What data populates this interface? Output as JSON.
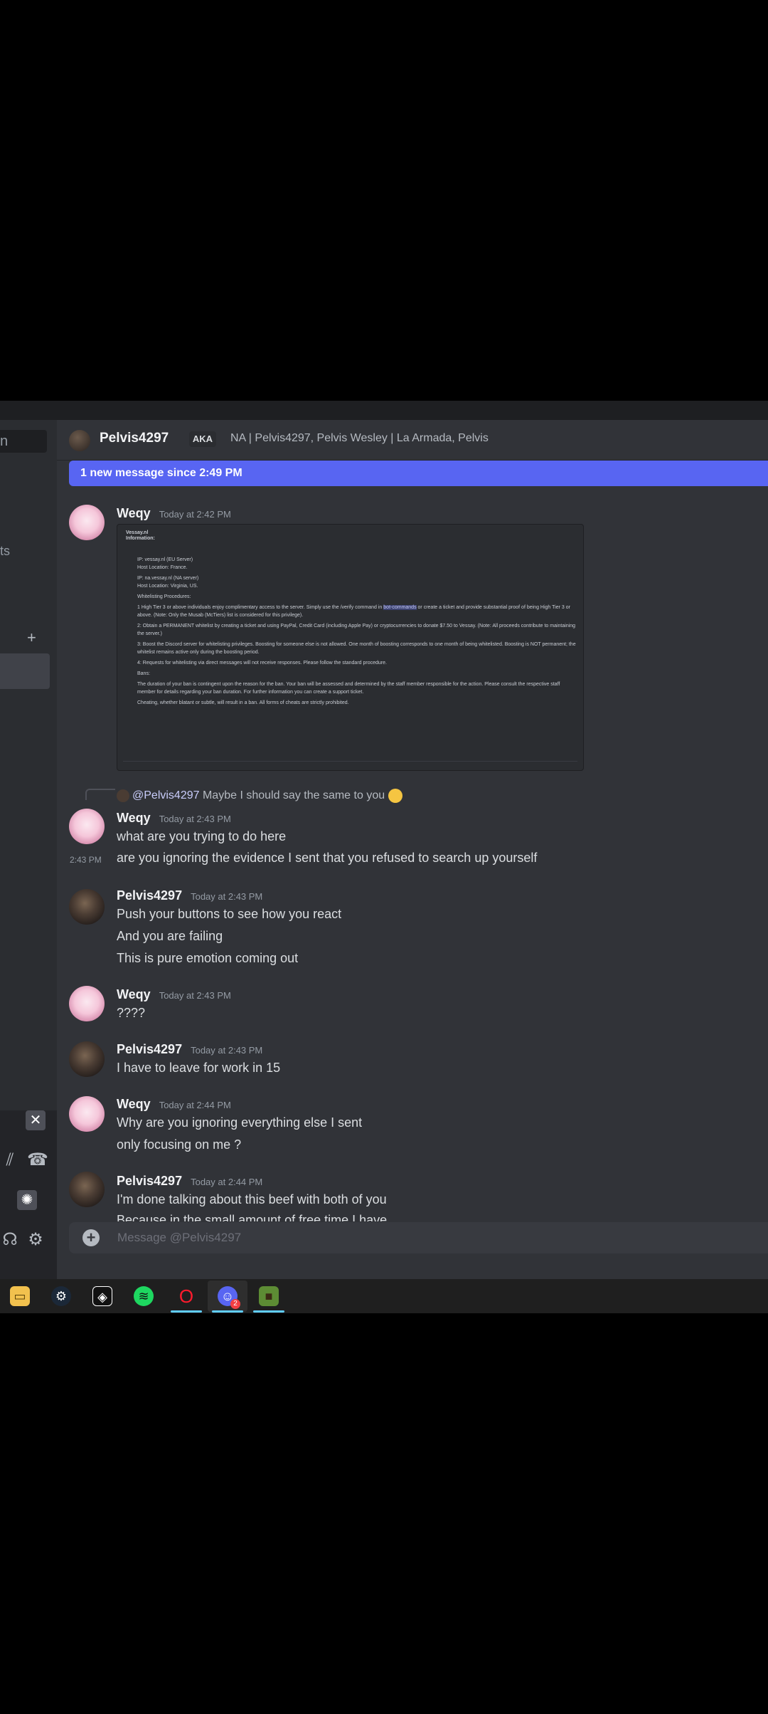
{
  "sidebar": {
    "search_text": "n",
    "fragment_text": "ts",
    "add_label": "+"
  },
  "header": {
    "channel_name": "Pelvis4297",
    "aka_label": "AKA",
    "aka_names": "NA | Pelvis4297, Pelvis Wesley | La Armada, Pelvis"
  },
  "new_messages_bar": "1 new message since 2:49 PM",
  "attachment": {
    "title": "Vessay.nl",
    "subtitle": "Information:",
    "lines": [
      "IP: vessay.nl (EU Server)",
      "Host Location: France.",
      "IP: na.vessay.nl (NA server)",
      "Host Location: Virginia, US.",
      "Whitelisting Procedures:",
      "1 High Tier 3 or above individuals enjoy complimentary access to the server. Simply use the /verify command in",
      "bot-commands",
      "or create a ticket and provide substantial proof of being High Tier 3 or above. (Note: Only the Musab (McTiers) list is considered for this privilege).",
      "2: Obtain a PERMANENT whitelist by creating a ticket and using PayPal, Credit Card (including Apple Pay) or cryptocurrencies to donate $7.50 to Vessay. (Note: All proceeds contribute to maintaining the server.)",
      "3: Boost the Discord server for whitelisting privileges. Boosting for someone else is not allowed. One month of boosting corresponds to one month of being whitelisted. Boosting is NOT permanent; the whitelist remains active only during the boosting period.",
      "4: Requests for whitelisting via direct messages will not receive responses. Please follow the standard procedure.",
      "Bans:",
      "The duration of your ban is contingent upon the reason for the ban. Your ban will be assessed and determined by the staff member responsible for the action. Please consult the respective staff member for details regarding your ban duration. For further information you can create a support ticket.",
      "Cheating, whether blatant or subtle, will result in a ban. All forms of cheats are strictly prohibited."
    ]
  },
  "reply": {
    "mention": "@Pelvis4297",
    "text": "Maybe I should say the same to you"
  },
  "messages": [
    {
      "author": "Weqy",
      "time": "Today at 2:42 PM"
    },
    {
      "author": "Weqy",
      "time": "Today at 2:43 PM",
      "lines": [
        "what are you trying to do here"
      ]
    },
    {
      "hover_time": "2:43 PM",
      "lines": [
        "are you ignoring the evidence I sent that you refused to search up yourself"
      ]
    },
    {
      "author": "Pelvis4297",
      "time": "Today at 2:43 PM",
      "lines": [
        "Push your buttons to see how you react",
        "And you are failing",
        "This is pure emotion coming out"
      ]
    },
    {
      "author": "Weqy",
      "time": "Today at 2:43 PM",
      "lines": [
        "????"
      ]
    },
    {
      "author": "Pelvis4297",
      "time": "Today at 2:43 PM",
      "lines": [
        "I have to leave for work in 15"
      ]
    },
    {
      "author": "Weqy",
      "time": "Today at 2:44 PM",
      "lines": [
        "Why are you ignoring everything else I sent",
        "only focusing on me ?"
      ]
    },
    {
      "author": "Pelvis4297",
      "time": "Today at 2:44 PM",
      "lines": [
        "I'm done talking about this beef with both of you",
        "Because in the small amount of free time I have"
      ]
    }
  ],
  "composer": {
    "placeholder": "Message @Pelvis4297"
  },
  "taskbar": {
    "discord_badge": "2"
  }
}
